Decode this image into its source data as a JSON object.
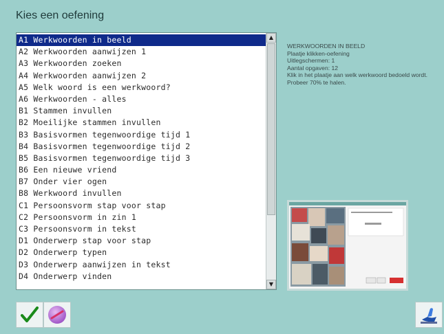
{
  "window": {
    "title": "Kies een oefening"
  },
  "exercise_list": {
    "selected_index": 0,
    "items": [
      "A1 Werkwoorden in beeld",
      "A2 Werkwoorden aanwijzen 1",
      "A3 Werkwoorden zoeken",
      "A4 Werkwoorden aanwijzen 2",
      "A5 Welk woord is een werkwoord?",
      "A6 Werkwoorden - alles",
      "B1 Stammen invullen",
      "B2 Moeilijke stammen invullen",
      "B3 Basisvormen tegenwoordige tijd 1",
      "B4 Basisvormen tegenwoordige tijd 2",
      "B5 Basisvormen tegenwoordige tijd 3",
      "B6 Een nieuwe vriend",
      "B7 Onder vier ogen",
      "B8 Werkwoord invullen",
      "C1 Persoonsvorm stap voor stap",
      "C2 Persoonsvorm in zin 1",
      "C3 Persoonsvorm in tekst",
      "D1 Onderwerp stap voor stap",
      "D2 Onderwerp typen",
      "D3 Onderwerp aanwijzen in tekst",
      "D4 Onderwerp vinden"
    ]
  },
  "scroll": {
    "up_icon": "▲",
    "down_icon": "▼"
  },
  "description": {
    "lines": [
      "WERKWOORDEN IN BEELD",
      "Plaatje klikken-oefening",
      "Uitlegschermen: 1",
      "Aantal opgaven: 12",
      "Klik in het plaatje aan welk werkwoord bedoeld wordt.",
      "Probeer 70% te halen."
    ]
  },
  "buttons": {
    "ok": {
      "icon": "checkmark-icon",
      "color": "#1a8a1a"
    },
    "stop": {
      "icon": "no-entry-icon",
      "color": "#b06fd0"
    },
    "exit": {
      "icon": "door-exit-icon",
      "color": "#1f4fa8"
    }
  },
  "colors": {
    "background": "#9ccfcb",
    "selection": "#0f2a8a"
  }
}
